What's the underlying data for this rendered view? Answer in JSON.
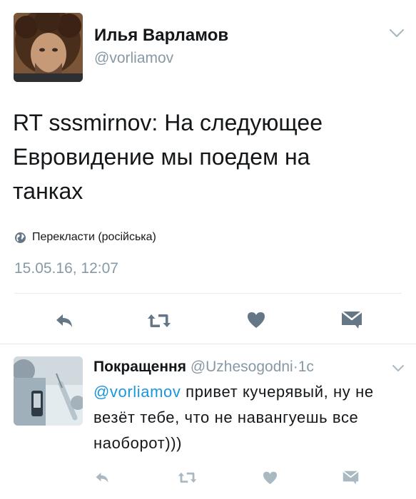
{
  "tweet": {
    "author_name": "Илья Варламов",
    "author_handle": "@vorliamov",
    "text": "RT sssmirnov: На следующее\nЕвровидение мы поедем на\nтанках",
    "translate_label": "Перекласти (російська)",
    "timestamp": "15.05.16, 12:07",
    "actions": [
      "reply-icon",
      "retweet-icon",
      "like-icon",
      "direct-message-icon"
    ]
  },
  "reply": {
    "author_name": "Покращення",
    "author_handle": "@Uzhesogodni",
    "separator": "·",
    "time": "1с",
    "mention": "@vorliamov",
    "text": " привет кучерявый, ну не везёт тебе, что не навангуешь все наоборот)))",
    "actions": [
      "reply-icon",
      "retweet-icon",
      "like-icon",
      "direct-message-icon"
    ]
  },
  "colors": {
    "text": "#14171a",
    "secondary": "#8899a6",
    "link": "#1b95e0",
    "icon": "#657786",
    "divider": "#e6ecf0"
  }
}
